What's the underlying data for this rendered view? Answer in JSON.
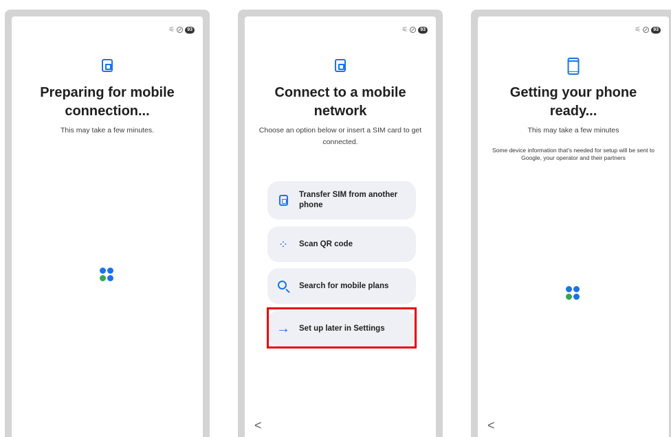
{
  "status_bar": {
    "battery": "93"
  },
  "screen1": {
    "title": "Preparing for mobile connection...",
    "subtitle": "This may take a few minutes."
  },
  "screen2": {
    "title": "Connect to a mobile network",
    "subtitle": "Choose an option below or insert a SIM card to get connected.",
    "options": [
      {
        "label": "Transfer SIM from another phone",
        "icon": "sim-card-icon"
      },
      {
        "label": "Scan QR code",
        "icon": "qr-code-icon"
      },
      {
        "label": "Search for mobile plans",
        "icon": "search-icon"
      },
      {
        "label": "Set up later in Settings",
        "icon": "arrow-right-icon",
        "highlighted": true
      }
    ],
    "back_glyph": "<"
  },
  "screen3": {
    "title": "Getting your phone ready...",
    "subtitle": "This may take a few minutes",
    "note": "Some device information that's needed for setup will be sent to Google, your operator and their partners",
    "back_glyph": "<"
  },
  "colors": {
    "accent": "#1a73e8",
    "highlight": "#e8000b",
    "loader_green": "#34a853"
  }
}
